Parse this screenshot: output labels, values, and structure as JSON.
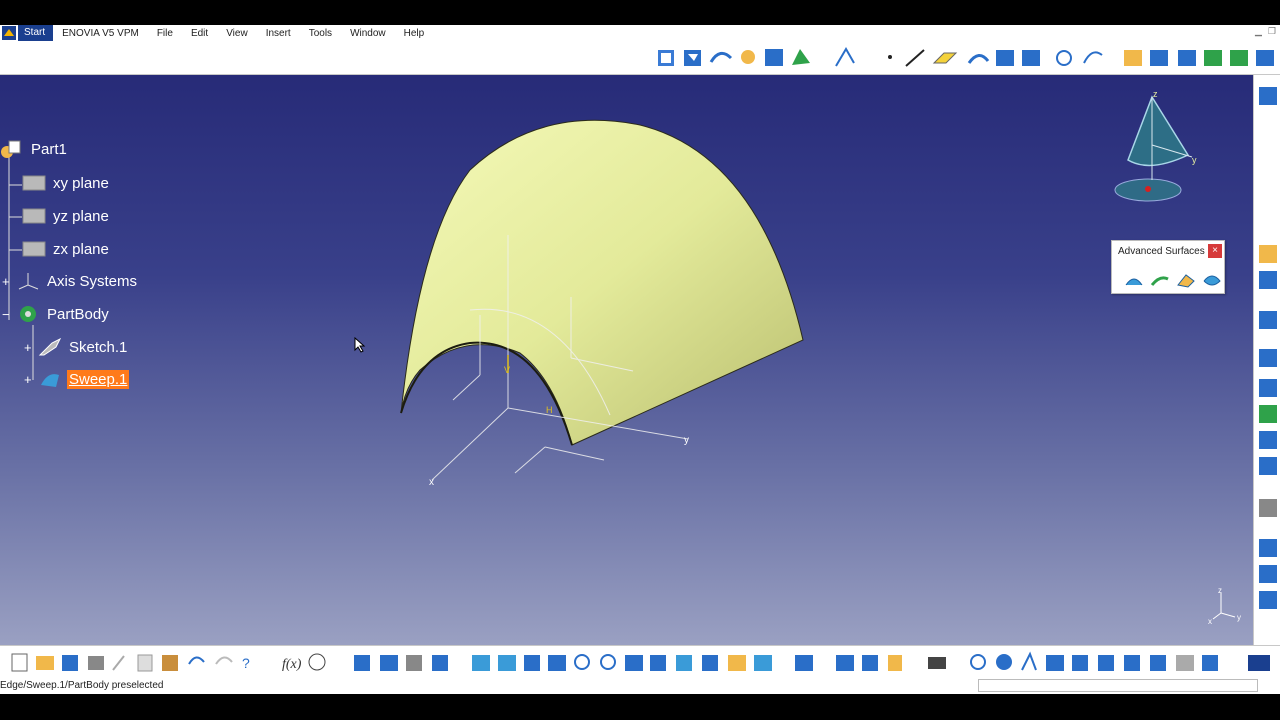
{
  "menu": {
    "items": [
      "Start",
      "ENOVIA V5 VPM",
      "File",
      "Edit",
      "View",
      "Insert",
      "Tools",
      "Window",
      "Help"
    ]
  },
  "tree": {
    "root": "Part1",
    "xy_plane": "xy plane",
    "yz_plane": "yz plane",
    "zx_plane": "zx plane",
    "axis_systems": "Axis Systems",
    "part_body": "PartBody",
    "sketch": "Sketch.1",
    "sweep": "Sweep.1"
  },
  "advanced_surfaces": {
    "title": "Advanced Surfaces",
    "close": "×"
  },
  "axis_labels": {
    "compass_z": "z",
    "compass_y": "y",
    "model_x": "x",
    "model_y": "y",
    "model_h": "H",
    "mini_z": "z",
    "mini_x": "x",
    "mini_y": "y"
  },
  "status": {
    "text": "Edge/Sweep.1/PartBody preselected"
  },
  "colors": {
    "selection": "#ff7a1a",
    "surface": "#e9f1a6",
    "viewport_top": "#272b78",
    "viewport_bottom": "#9aa0c2"
  }
}
